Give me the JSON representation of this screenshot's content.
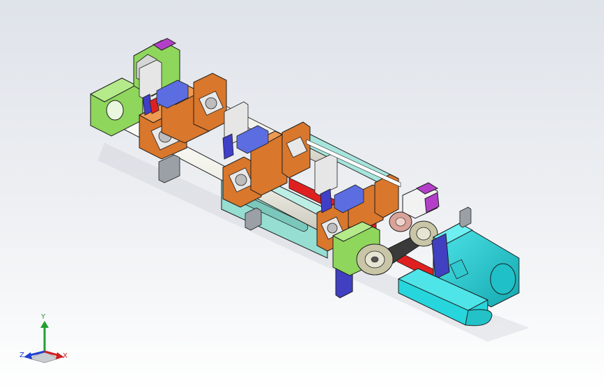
{
  "viewport": {
    "background_top": "#dfe3ea",
    "background_bottom": "#ffffff"
  },
  "model": {
    "colors": {
      "green_plate": "#8fd65c",
      "orange_block": "#d9772c",
      "cyan_frame": "#96ddd2",
      "cyan_motor": "#27d6dc",
      "blue_block": "#3f3fc8",
      "purple_block": "#b33fc8",
      "red_accent": "#e02020",
      "shaft_white": "#f5f5ef",
      "steel_gray": "#9aa0a6",
      "pulley_beige": "#c9c6a8",
      "outline": "#1e1e1e"
    }
  },
  "triad": {
    "y_label": "Y",
    "z_label": "Z",
    "x_label": "X",
    "y_color": "#20a030",
    "z_color": "#2040d0",
    "x_color": "#d02020"
  }
}
